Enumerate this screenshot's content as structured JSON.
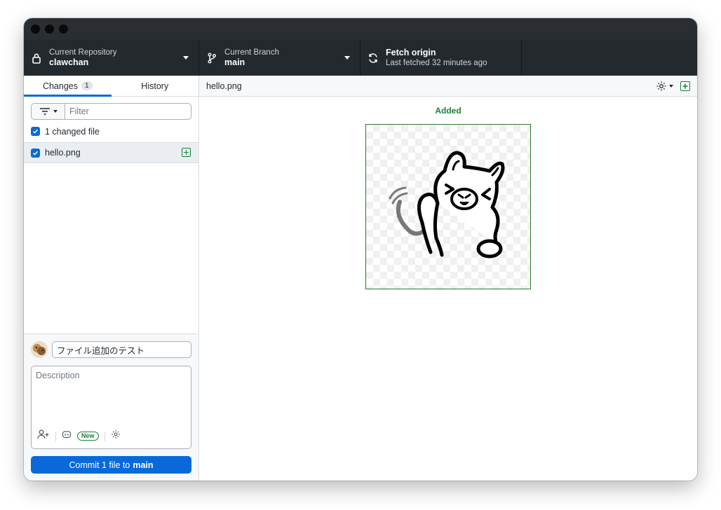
{
  "toolbar": {
    "repository": {
      "label": "Current Repository",
      "value": "clawchan"
    },
    "branch": {
      "label": "Current Branch",
      "value": "main"
    },
    "fetch": {
      "title": "Fetch origin",
      "subtitle": "Last fetched 32 minutes ago"
    }
  },
  "sidebar": {
    "tabs": [
      {
        "label": "Changes",
        "count": "1"
      },
      {
        "label": "History"
      }
    ],
    "filter": {
      "placeholder": "Filter"
    },
    "changed_summary": "1 changed file",
    "files": [
      {
        "name": "hello.png",
        "status": "added"
      }
    ]
  },
  "commit": {
    "summary_value": "ファイル追加のテスト",
    "description_placeholder": "Description",
    "new_badge": "New",
    "button_prefix": "Commit 1 file to",
    "button_branch": "main"
  },
  "diff": {
    "file_name": "hello.png",
    "status_label": "Added"
  },
  "colors": {
    "accent": "#0969da",
    "added": "#1a7f37",
    "toolbar_bg": "#24292e"
  }
}
